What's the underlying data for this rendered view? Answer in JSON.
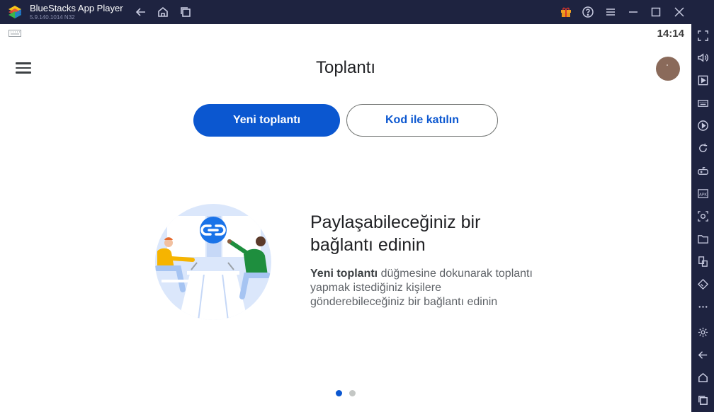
{
  "window": {
    "title": "BlueStacks App Player",
    "version": "5.9.140.1014  N32"
  },
  "statusbar": {
    "time": "14:14"
  },
  "header": {
    "title": "Toplantı"
  },
  "actions": {
    "new_meeting": "Yeni toplantı",
    "join_with_code": "Kod ile katılın"
  },
  "promo": {
    "heading_line1": "Paylaşabileceğiniz bir",
    "heading_line2": "bağlantı edinin",
    "body_bold": "Yeni toplantı",
    "body_rest": " düğmesine dokunarak toplantı yapmak istediğiniz kişilere gönderebileceğiniz bir bağlantı edinin"
  },
  "pager": {
    "current": 1,
    "total": 2
  },
  "colors": {
    "chrome": "#1e2340",
    "accent": "#0b57d0",
    "gift": "#f0a020"
  },
  "icons": {
    "titlebar": [
      "back-icon",
      "home-icon",
      "recents-icon",
      "gift-icon",
      "help-icon",
      "menu-icon",
      "minimize-icon",
      "maximize-icon",
      "close-icon"
    ],
    "sidebar": [
      "fullscreen-icon",
      "volume-icon",
      "media-icon",
      "keyboard-icon",
      "macro-icon",
      "rotate-icon",
      "gamepad-icon",
      "apk-icon",
      "screenshot-icon",
      "folder-icon",
      "multi-instance-icon",
      "eco-icon",
      "more-icon",
      "settings-icon",
      "back-icon",
      "home-icon",
      "recents-icon"
    ]
  }
}
